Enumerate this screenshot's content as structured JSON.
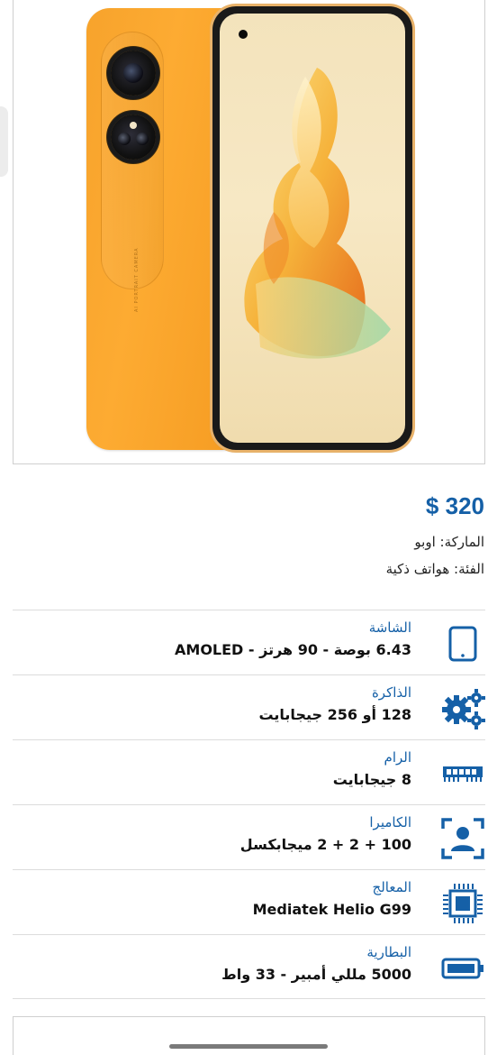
{
  "product": {
    "price": "$ 320",
    "brand": "الماركة: اوبو",
    "category": "الفئة: هواتف ذكية"
  },
  "specs": [
    {
      "label": "الشاشة",
      "value": "6.43 بوصة - 90 هرتز - AMOLED",
      "icon": "tablet-icon"
    },
    {
      "label": "الذاكرة",
      "value": "128 أو 256 جيجابايت",
      "icon": "gears-icon"
    },
    {
      "label": "الرام",
      "value": "8 جيجابايت",
      "icon": "ram-icon"
    },
    {
      "label": "الكاميرا",
      "value": "100 + 2 + 2 ميجابكسل",
      "icon": "camera-focus-icon"
    },
    {
      "label": "المعالج",
      "value": "Mediatek Helio G99",
      "icon": "cpu-chip-icon"
    },
    {
      "label": "البطارية",
      "value": "5000 مللي أمبير - 33 واط",
      "icon": "battery-icon"
    }
  ],
  "colors": {
    "accent": "#1560a7",
    "phone_orange": "#fdab32"
  }
}
